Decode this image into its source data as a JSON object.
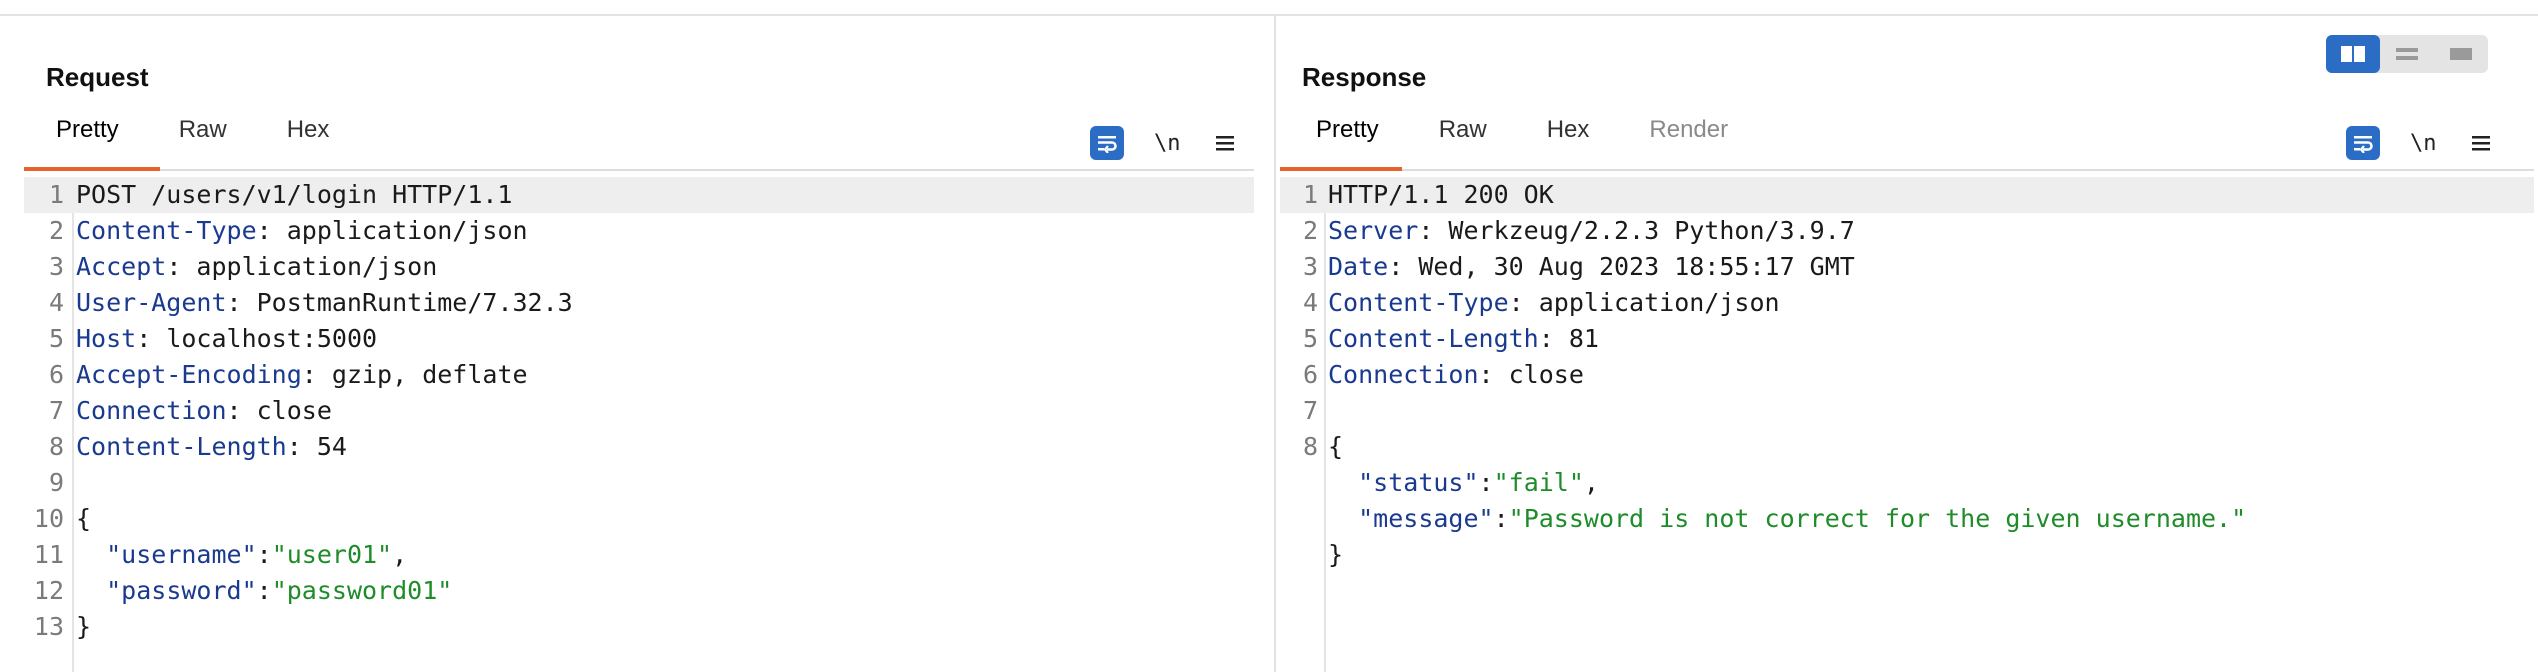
{
  "request": {
    "title": "Request",
    "tabs": [
      "Pretty",
      "Raw",
      "Hex"
    ],
    "lines": {
      "l1": {
        "num": "1",
        "text": "POST /users/v1/login HTTP/1.1"
      },
      "l2": {
        "num": "2",
        "name": "Content-Type",
        "value": " application/json"
      },
      "l3": {
        "num": "3",
        "name": "Accept",
        "value": " application/json"
      },
      "l4": {
        "num": "4",
        "name": "User-Agent",
        "value": " PostmanRuntime/7.32.3"
      },
      "l5": {
        "num": "5",
        "name": "Host",
        "value": " localhost:5000"
      },
      "l6": {
        "num": "6",
        "name": "Accept-Encoding",
        "value": " gzip, deflate"
      },
      "l7": {
        "num": "7",
        "name": "Connection",
        "value": " close"
      },
      "l8": {
        "num": "8",
        "name": "Content-Length",
        "value": " 54"
      },
      "l9": {
        "num": "9"
      },
      "l10": {
        "num": "10",
        "text": "{"
      },
      "l11": {
        "num": "11",
        "key": "\"username\"",
        "sep": ":",
        "val": "\"user01\"",
        "end": ","
      },
      "l12": {
        "num": "12",
        "key": "\"password\"",
        "sep": ":",
        "val": "\"password01\""
      },
      "l13": {
        "num": "13",
        "text": "}"
      }
    }
  },
  "response": {
    "title": "Response",
    "tabs": [
      "Pretty",
      "Raw",
      "Hex",
      "Render"
    ],
    "lines": {
      "l1": {
        "num": "1",
        "text": "HTTP/1.1 200 OK"
      },
      "l2": {
        "num": "2",
        "name": "Server",
        "value": " Werkzeug/2.2.3 Python/3.9.7"
      },
      "l3": {
        "num": "3",
        "name": "Date",
        "value": " Wed, 30 Aug 2023 18:55:17 GMT"
      },
      "l4": {
        "num": "4",
        "name": "Content-Type",
        "value": " application/json"
      },
      "l5": {
        "num": "5",
        "name": "Content-Length",
        "value": " 81"
      },
      "l6": {
        "num": "6",
        "name": "Connection",
        "value": " close"
      },
      "l7": {
        "num": "7"
      },
      "l8": {
        "num": "8",
        "text": "{"
      },
      "l9": {
        "key": "\"status\"",
        "sep": ":",
        "val": "\"fail\"",
        "end": ","
      },
      "l10": {
        "key": "\"message\"",
        "sep": ":",
        "val": "\"Password is not correct for the given username.\""
      },
      "l11": {
        "text": "}"
      }
    }
  },
  "toolbar": {
    "wrap_icon": "text-wrap-icon",
    "newline_label": "\\n",
    "menu_icon": "hamburger-menu-icon"
  },
  "layout_toggle": {
    "options": [
      "side-by-side-icon",
      "stacked-icon",
      "single-pane-icon"
    ],
    "active": "side-by-side-icon",
    "accent": "#2b6cc4"
  },
  "colors": {
    "tab_underline": "#e8622b",
    "header_name": "#1a3a8f",
    "json_string": "#1f8c2a"
  }
}
